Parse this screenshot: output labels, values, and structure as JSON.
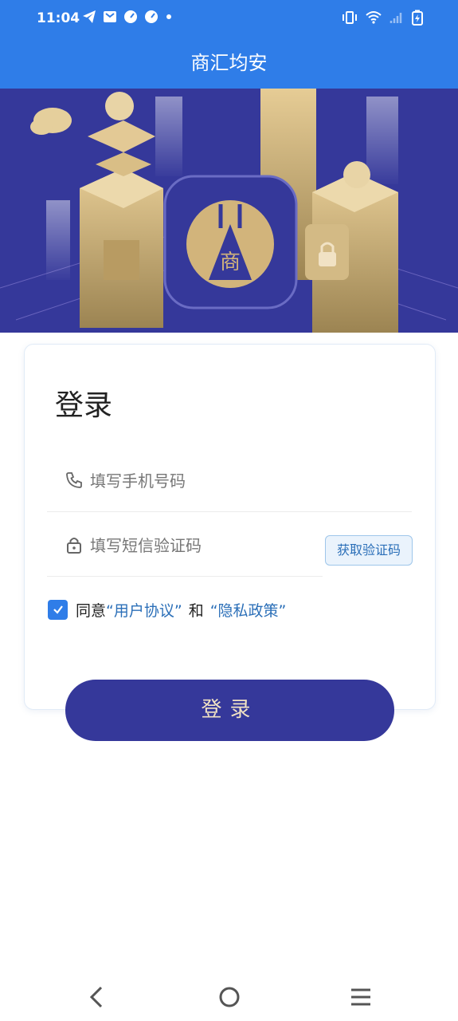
{
  "status_bar": {
    "time": "11:04",
    "left_icons": [
      "telegram-icon",
      "mail-icon",
      "speedometer-icon",
      "speedometer-icon",
      "dot-icon"
    ],
    "right_icons": [
      "vibrate-icon",
      "wifi-icon",
      "signal-icon",
      "battery-charging-icon"
    ]
  },
  "app_bar": {
    "title": "商汇均安"
  },
  "banner": {
    "logo_char": "商"
  },
  "login_card": {
    "heading": "登录",
    "phone_placeholder": "填写手机号码",
    "code_placeholder": "填写短信验证码",
    "get_code_label": "获取验证码",
    "agree_prefix": "同意",
    "user_agreement": "“用户协议”",
    "and_text": "和",
    "privacy_policy": "“隐私政策”",
    "agreement_checked": true
  },
  "login_button_label": "登录",
  "nav_bar": {
    "buttons": [
      "back-icon",
      "home-icon",
      "menu-icon"
    ]
  },
  "colors": {
    "accent": "#2f7de8",
    "brand": "#35389a",
    "gold": "#d2b47b",
    "link": "#2b6fb8"
  }
}
